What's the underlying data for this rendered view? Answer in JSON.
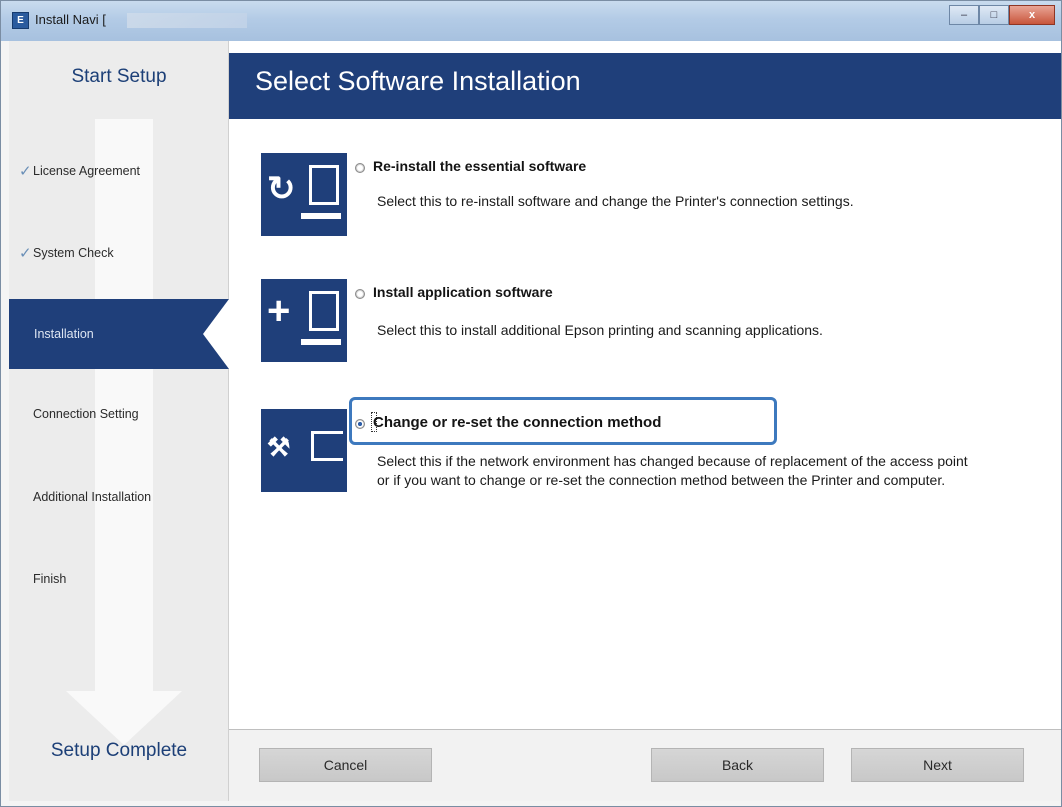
{
  "window": {
    "title": "Install Navi [",
    "app_icon_letter": "E",
    "controls": [
      "minimize",
      "maximize",
      "close"
    ],
    "close_label": "x"
  },
  "sidebar": {
    "header": "Start Setup",
    "footer": "Setup Complete",
    "steps": [
      {
        "label": "License Agreement",
        "done": true
      },
      {
        "label": "System Check",
        "done": true
      },
      {
        "label": "Installation",
        "active": true
      },
      {
        "label": "Connection Setting"
      },
      {
        "label": "Additional Installation"
      },
      {
        "label": "Finish"
      }
    ],
    "check_glyph": "✓"
  },
  "main": {
    "title": "Select Software Installation",
    "options": [
      {
        "icon": "refresh-computer-icon",
        "glyph": "↻",
        "title": "Re-install the essential software",
        "description": "Select this to re-install software and change the Printer's connection settings.",
        "selected": false
      },
      {
        "icon": "add-computer-icon",
        "glyph": "+",
        "title": "Install application software",
        "description": "Select this to install additional Epson printing and scanning applications.",
        "selected": false
      },
      {
        "icon": "tools-printer-icon",
        "glyph": "⚒",
        "title": "Change or re-set the connection method",
        "description": "Select this if the network environment has changed because of replacement of the access point or if you want to change or re-set the connection method between the Printer and computer.",
        "selected": true
      }
    ]
  },
  "footer": {
    "cancel": "Cancel",
    "back": "Back",
    "next": "Next"
  },
  "colors": {
    "accent": "#1f3f7a",
    "highlight": "#3d79be",
    "heading_text": "#1c3f77"
  }
}
